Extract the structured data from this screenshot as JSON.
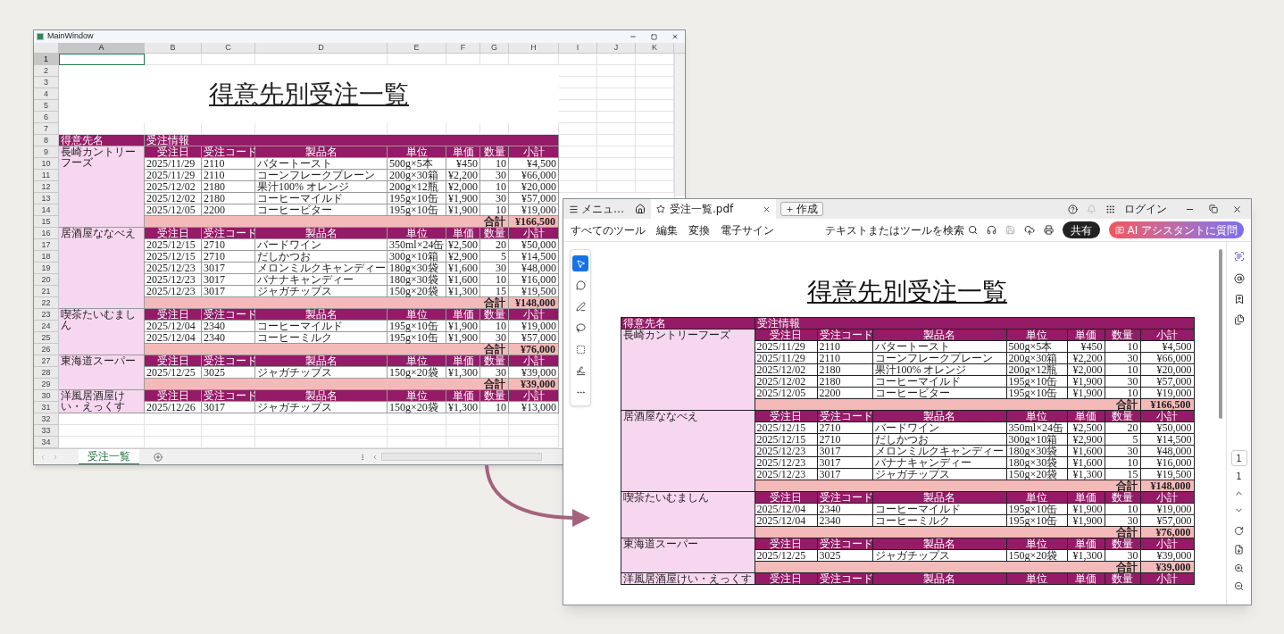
{
  "excel_window": {
    "title": "MainWindow",
    "columns": [
      {
        "label": "A",
        "selected": true
      },
      {
        "label": "B",
        "selected": false
      },
      {
        "label": "C",
        "selected": false
      },
      {
        "label": "D",
        "selected": false
      },
      {
        "label": "E",
        "selected": false
      },
      {
        "label": "F",
        "selected": false
      },
      {
        "label": "G",
        "selected": false
      },
      {
        "label": "H",
        "selected": false
      },
      {
        "label": "I",
        "selected": false
      },
      {
        "label": "J",
        "selected": false
      },
      {
        "label": "K",
        "selected": false
      }
    ],
    "rows": [
      {
        "label": "1",
        "selected": true
      },
      {
        "label": "2",
        "selected": false
      },
      {
        "label": "3",
        "selected": false
      },
      {
        "label": "4",
        "selected": false
      },
      {
        "label": "5",
        "selected": false
      },
      {
        "label": "6",
        "selected": false
      },
      {
        "label": "7",
        "selected": false
      },
      {
        "label": "8",
        "selected": false
      },
      {
        "label": "9",
        "selected": false
      },
      {
        "label": "10",
        "selected": false
      },
      {
        "label": "11",
        "selected": false
      },
      {
        "label": "12",
        "selected": false
      },
      {
        "label": "13",
        "selected": false
      },
      {
        "label": "14",
        "selected": false
      },
      {
        "label": "15",
        "selected": false
      },
      {
        "label": "16",
        "selected": false
      },
      {
        "label": "17",
        "selected": false
      },
      {
        "label": "18",
        "selected": false
      },
      {
        "label": "19",
        "selected": false
      },
      {
        "label": "20",
        "selected": false
      },
      {
        "label": "21",
        "selected": false
      },
      {
        "label": "22",
        "selected": false
      },
      {
        "label": "23",
        "selected": false
      },
      {
        "label": "24",
        "selected": false
      },
      {
        "label": "25",
        "selected": false
      },
      {
        "label": "26",
        "selected": false
      },
      {
        "label": "27",
        "selected": false
      },
      {
        "label": "28",
        "selected": false
      },
      {
        "label": "29",
        "selected": false
      },
      {
        "label": "30",
        "selected": false
      },
      {
        "label": "31",
        "selected": false
      },
      {
        "label": "32",
        "selected": false
      },
      {
        "label": "33",
        "selected": false
      },
      {
        "label": "34",
        "selected": false
      }
    ],
    "report": {
      "title": "得意先別受注一覧",
      "customer_heading": "得意先名",
      "orders_heading": "受注情報",
      "groups": [
        {
          "customer": "長崎カントリーフーズ",
          "columns": [
            "受注日",
            "受注コード",
            "製品名",
            "単位",
            "単価",
            "数量",
            "小計"
          ],
          "orders": [
            [
              "2025/11/29",
              "2110",
              "バタートースト",
              "500g×5本",
              "¥450",
              "10",
              "¥4,500"
            ],
            [
              "2025/11/29",
              "2110",
              "コーンフレークプレーン",
              "200g×30箱",
              "¥2,200",
              "30",
              "¥66,000"
            ],
            [
              "2025/12/02",
              "2180",
              "果汁100% オレンジ",
              "200g×12瓶",
              "¥2,000",
              "10",
              "¥20,000"
            ],
            [
              "2025/12/02",
              "2180",
              "コーヒーマイルド",
              "195g×10缶",
              "¥1,900",
              "30",
              "¥57,000"
            ],
            [
              "2025/12/05",
              "2200",
              "コーヒービター",
              "195g×10缶",
              "¥1,900",
              "10",
              "¥19,000"
            ]
          ],
          "total_label": "合計",
          "total": "¥166,500"
        },
        {
          "customer": "居酒屋ななべえ",
          "columns": [
            "受注日",
            "受注コード",
            "製品名",
            "単位",
            "単価",
            "数量",
            "小計"
          ],
          "orders": [
            [
              "2025/12/15",
              "2710",
              "バードワイン",
              "350ml×24缶",
              "¥2,500",
              "20",
              "¥50,000"
            ],
            [
              "2025/12/15",
              "2710",
              "だしかつお",
              "300g×10箱",
              "¥2,900",
              "5",
              "¥14,500"
            ],
            [
              "2025/12/23",
              "3017",
              "メロンミルクキャンディー",
              "180g×30袋",
              "¥1,600",
              "30",
              "¥48,000"
            ],
            [
              "2025/12/23",
              "3017",
              "バナナキャンディー",
              "180g×30袋",
              "¥1,600",
              "10",
              "¥16,000"
            ],
            [
              "2025/12/23",
              "3017",
              "ジャガチップス",
              "150g×20袋",
              "¥1,300",
              "15",
              "¥19,500"
            ]
          ],
          "total_label": "合計",
          "total": "¥148,000"
        },
        {
          "customer": "喫茶たいむましん",
          "columns": [
            "受注日",
            "受注コード",
            "製品名",
            "単位",
            "単価",
            "数量",
            "小計"
          ],
          "orders": [
            [
              "2025/12/04",
              "2340",
              "コーヒーマイルド",
              "195g×10缶",
              "¥1,900",
              "10",
              "¥19,000"
            ],
            [
              "2025/12/04",
              "2340",
              "コーヒーミルク",
              "195g×10缶",
              "¥1,900",
              "30",
              "¥57,000"
            ]
          ],
          "total_label": "合計",
          "total": "¥76,000"
        },
        {
          "customer": "東海道スーパー",
          "columns": [
            "受注日",
            "受注コード",
            "製品名",
            "単位",
            "単価",
            "数量",
            "小計"
          ],
          "orders": [
            [
              "2025/12/25",
              "3025",
              "ジャガチップス",
              "150g×20袋",
              "¥1,300",
              "30",
              "¥39,000"
            ]
          ],
          "total_label": "合計",
          "total": "¥39,000"
        },
        {
          "customer": "洋風居酒屋けい・えっくす",
          "columns": [
            "受注日",
            "受注コード",
            "製品名",
            "単位",
            "単価",
            "数量",
            "小計"
          ],
          "orders": [
            [
              "2025/12/26",
              "3017",
              "ジャガチップス",
              "150g×20袋",
              "¥1,300",
              "10",
              "¥13,000"
            ]
          ]
        }
      ]
    },
    "sheet_tabs": [
      {
        "label": "受注一覧",
        "selected": true
      }
    ]
  },
  "pdf_viewer": {
    "menu": "メニュ…",
    "tabs": [
      {
        "label": "受注一覧.pdf",
        "selected": true
      }
    ],
    "create_button": "作成",
    "login": "ログイン",
    "toolbar": [
      "すべてのツール",
      "編集",
      "変換",
      "電子サイン"
    ],
    "search": {
      "placeholder": "テキストまたはツールを検索"
    },
    "share_button": "共有",
    "ai_button": "AI アシスタントに質問",
    "tools": [
      {
        "selected": true
      },
      {
        "selected": false
      },
      {
        "selected": false
      },
      {
        "selected": false
      },
      {
        "selected": false
      },
      {
        "selected": false
      },
      {
        "selected": false
      }
    ],
    "page_field": "1",
    "page_count": "1",
    "report": {
      "title": "得意先別受注一覧",
      "customer_heading": "得意先名",
      "orders_heading": "受注情報",
      "groups": [
        {
          "customer": "長崎カントリーフーズ",
          "columns": [
            "受注日",
            "受注コード",
            "製品名",
            "単位",
            "単価",
            "数量",
            "小計"
          ],
          "orders": [
            [
              "2025/11/29",
              "2110",
              "バタートースト",
              "500g×5本",
              "¥450",
              "10",
              "¥4,500"
            ],
            [
              "2025/11/29",
              "2110",
              "コーンフレークプレーン",
              "200g×30箱",
              "¥2,200",
              "30",
              "¥66,000"
            ],
            [
              "2025/12/02",
              "2180",
              "果汁100% オレンジ",
              "200g×12瓶",
              "¥2,000",
              "10",
              "¥20,000"
            ],
            [
              "2025/12/02",
              "2180",
              "コーヒーマイルド",
              "195g×10缶",
              "¥1,900",
              "30",
              "¥57,000"
            ],
            [
              "2025/12/05",
              "2200",
              "コーヒービター",
              "195g×10缶",
              "¥1,900",
              "10",
              "¥19,000"
            ]
          ],
          "total_label": "合計",
          "total": "¥166,500"
        },
        {
          "customer": "居酒屋ななべえ",
          "columns": [
            "受注日",
            "受注コード",
            "製品名",
            "単位",
            "単価",
            "数量",
            "小計"
          ],
          "orders": [
            [
              "2025/12/15",
              "2710",
              "バードワイン",
              "350ml×24缶",
              "¥2,500",
              "20",
              "¥50,000"
            ],
            [
              "2025/12/15",
              "2710",
              "だしかつお",
              "300g×10箱",
              "¥2,900",
              "5",
              "¥14,500"
            ],
            [
              "2025/12/23",
              "3017",
              "メロンミルクキャンディー",
              "180g×30袋",
              "¥1,600",
              "30",
              "¥48,000"
            ],
            [
              "2025/12/23",
              "3017",
              "バナナキャンディー",
              "180g×30袋",
              "¥1,600",
              "10",
              "¥16,000"
            ],
            [
              "2025/12/23",
              "3017",
              "ジャガチップス",
              "150g×20袋",
              "¥1,300",
              "15",
              "¥19,500"
            ]
          ],
          "total_label": "合計",
          "total": "¥148,000"
        },
        {
          "customer": "喫茶たいむましん",
          "columns": [
            "受注日",
            "受注コード",
            "製品名",
            "単位",
            "単価",
            "数量",
            "小計"
          ],
          "orders": [
            [
              "2025/12/04",
              "2340",
              "コーヒーマイルド",
              "195g×10缶",
              "¥1,900",
              "10",
              "¥19,000"
            ],
            [
              "2025/12/04",
              "2340",
              "コーヒーミルク",
              "195g×10缶",
              "¥1,900",
              "30",
              "¥57,000"
            ]
          ],
          "total_label": "合計",
          "total": "¥76,000"
        },
        {
          "customer": "東海道スーパー",
          "columns": [
            "受注日",
            "受注コード",
            "製品名",
            "単位",
            "単価",
            "数量",
            "小計"
          ],
          "orders": [
            [
              "2025/12/25",
              "3025",
              "ジャガチップス",
              "150g×20袋",
              "¥1,300",
              "30",
              "¥39,000"
            ]
          ],
          "total_label": "合計",
          "total": "¥39,000"
        },
        {
          "customer": "洋風居酒屋けい・えっくす",
          "columns": [
            "受注日",
            "受注コード",
            "製品名",
            "単位",
            "単価",
            "数量",
            "小計"
          ]
        }
      ]
    }
  }
}
